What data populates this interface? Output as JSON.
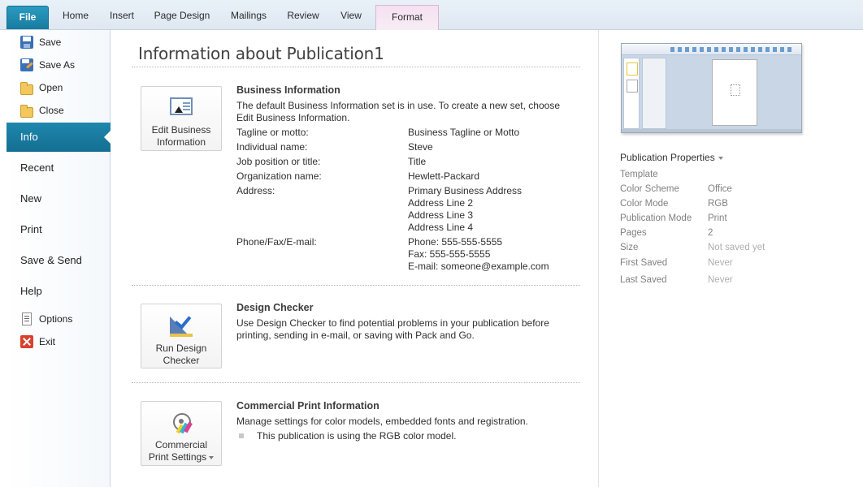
{
  "ribbon": {
    "tabs": [
      {
        "id": "file",
        "label": "File"
      },
      {
        "id": "home",
        "label": "Home"
      },
      {
        "id": "insert",
        "label": "Insert"
      },
      {
        "id": "page_design",
        "label": "Page Design"
      },
      {
        "id": "mailings",
        "label": "Mailings"
      },
      {
        "id": "review",
        "label": "Review"
      },
      {
        "id": "view",
        "label": "View"
      },
      {
        "id": "format",
        "label": "Format"
      }
    ]
  },
  "nav": {
    "save": "Save",
    "save_as": "Save As",
    "open": "Open",
    "close": "Close",
    "info": "Info",
    "recent": "Recent",
    "new": "New",
    "print": "Print",
    "save_send": "Save & Send",
    "help": "Help",
    "options": "Options",
    "exit": "Exit",
    "active": "Info",
    "accent_color": "#1a7ca3"
  },
  "main": {
    "title": "Information about Publication1",
    "business": {
      "button_label_1": "Edit Business",
      "button_label_2": "Information",
      "heading": "Business Information",
      "description": "The default Business Information set is in use. To create a new set, choose Edit Business Information.",
      "fields": {
        "tagline": {
          "label": "Tagline or motto:",
          "value": "Business Tagline or Motto"
        },
        "individual": {
          "label": "Individual name:",
          "value": "Steve"
        },
        "job": {
          "label": "Job position or title:",
          "value": "Title"
        },
        "organization": {
          "label": "Organization name:",
          "value": "Hewlett-Packard"
        },
        "address": {
          "label": "Address:",
          "lines": [
            "Primary Business Address",
            "Address Line 2",
            "Address Line 3",
            "Address Line 4"
          ]
        },
        "contact": {
          "label": "Phone/Fax/E-mail:",
          "lines": [
            "Phone: 555-555-5555",
            "Fax: 555-555-5555",
            "E-mail: someone@example.com"
          ]
        }
      }
    },
    "design_checker": {
      "button_label_1": "Run Design",
      "button_label_2": "Checker",
      "heading": "Design Checker",
      "description": "Use Design Checker to find potential problems in your publication before printing, sending in e-mail, or saving with Pack and Go."
    },
    "commercial_print": {
      "button_label_1": "Commercial",
      "button_label_2": "Print Settings",
      "heading": "Commercial Print Information",
      "description": "Manage settings for color models, embedded fonts and registration.",
      "bullet": "This publication is using the RGB color model."
    }
  },
  "properties": {
    "title": "Publication Properties",
    "items": [
      {
        "label": "Template",
        "value": ""
      },
      {
        "label": "Color Scheme",
        "value": "Office"
      },
      {
        "label": "Color Mode",
        "value": "RGB"
      },
      {
        "label": "Publication Mode",
        "value": "Print"
      },
      {
        "label": "Pages",
        "value": "2"
      },
      {
        "label": "Size",
        "value": "Not saved yet"
      },
      {
        "label": "First Saved",
        "value": "Never"
      },
      {
        "label": "Last Saved",
        "value": "Never"
      }
    ]
  }
}
